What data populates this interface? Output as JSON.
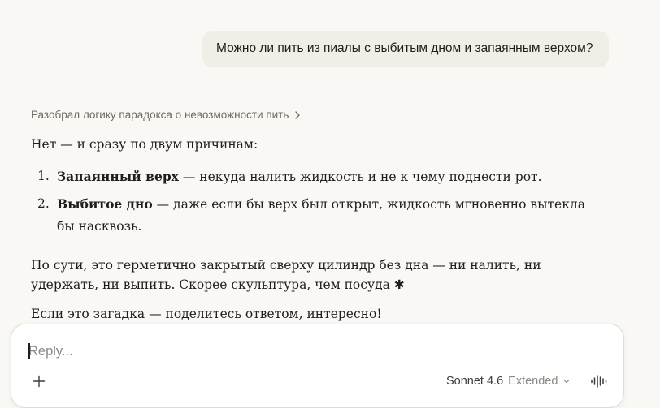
{
  "conversation": {
    "user_message": "Можно ли пить из пиалы с выбитым дном и запаянным верхом?",
    "thinking_summary": "Разобрал логику парадокса о невозможности пить",
    "response": {
      "intro": "Нет — и сразу по двум причинам:",
      "points": [
        {
          "number": "1.",
          "title": "Запаянный верх",
          "text": " — некуда налить жидкость и не к чему поднести рот."
        },
        {
          "number": "2.",
          "title": "Выбитое дно",
          "text": " — даже если бы верх был открыт, жидкость мгновенно вытекла бы насквозь."
        }
      ],
      "paragraph_2": "По сути, это герметично закрытый сверху цилиндр без дна — ни налить, ни удержать, ни выпить. Скорее скульптура, чем посуда ✱",
      "closing": "Если это загадка — поделитесь ответом, интересно!"
    }
  },
  "composer": {
    "placeholder": "Reply...",
    "value": "",
    "model_name": "Sonnet 4.6",
    "model_mode": "Extended"
  },
  "icons": {
    "thinking_chevron": "chevron-right-icon",
    "attach": "plus-icon",
    "model_dropdown": "chevron-down-icon",
    "voice": "waveform-icon"
  }
}
